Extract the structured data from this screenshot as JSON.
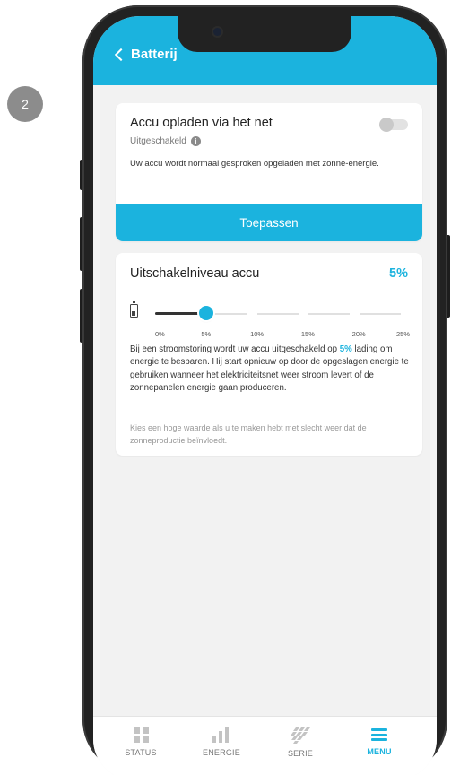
{
  "step_badge": "2",
  "header": {
    "title": "Batterij"
  },
  "grid_card": {
    "title": "Accu opladen via het net",
    "status": "Uitgeschakeld",
    "toggle_on": false,
    "description": "Uw accu wordt normaal gesproken opgeladen met zonne-energie.",
    "apply_label": "Toepassen"
  },
  "cutoff_card": {
    "title": "Uitschakelniveau accu",
    "value": "5%",
    "slider_value": 5,
    "slider_max": 25,
    "ticks": [
      "0%",
      "5%",
      "10%",
      "15%",
      "20%",
      "25%"
    ],
    "desc_before": "Bij een stroomstoring wordt uw accu uitgeschakeld op ",
    "desc_highlight": "5%",
    "desc_after": " lading om energie te besparen. Hij start opnieuw op door de opgeslagen energie te gebruiken wanneer het elektriciteitsnet weer stroom levert of de zonnepanelen energie gaan produceren.",
    "hint": "Kies een hoge waarde als u te maken hebt met slecht weer dat de zonneproductie beïnvloedt."
  },
  "tabs": [
    {
      "label": "STATUS",
      "icon": "grid-icon"
    },
    {
      "label": "ENERGIE",
      "icon": "bar-chart-icon"
    },
    {
      "label": "SERIE",
      "icon": "solar-panel-icon"
    },
    {
      "label": "MENU",
      "icon": "menu-icon",
      "active": true
    }
  ],
  "colors": {
    "accent": "#1bb3de",
    "inactive": "#c3c3c3"
  }
}
